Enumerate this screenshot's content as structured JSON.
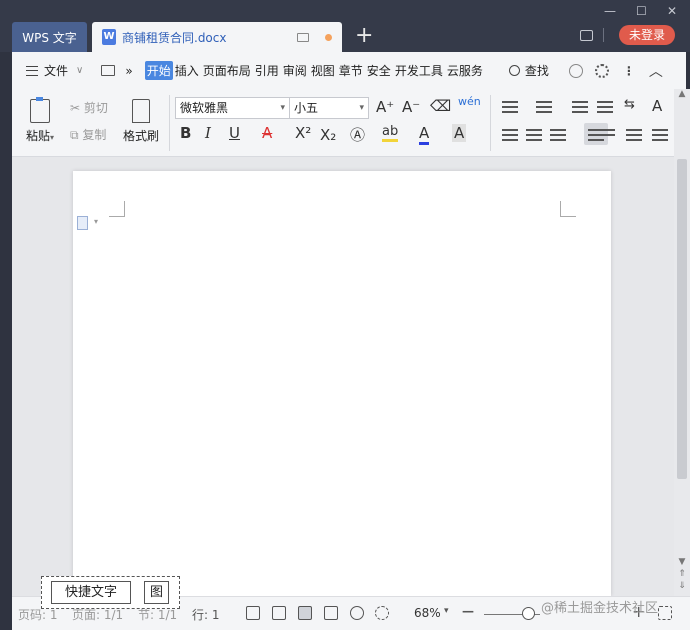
{
  "window": {
    "app_tab": "WPS 文字",
    "doc_tab": "商铺租赁合同.docx",
    "new_tab": "+",
    "login": "未登录",
    "min": "—",
    "max": "☐",
    "close": "✕"
  },
  "menubar": {
    "file": "文件",
    "file_arrow": "∨",
    "more": "»",
    "items": [
      "开始",
      "插入",
      "页面布局",
      "引用",
      "审阅",
      "视图",
      "章节",
      "安全",
      "开发工具",
      "云服务"
    ],
    "search": "查找"
  },
  "ribbon": {
    "paste": "粘贴",
    "cut": "剪切",
    "copy": "复制",
    "format_painter": "格式刷",
    "font_name": "微软雅黑",
    "font_size": "小五",
    "grow": "A⁺",
    "shrink": "A⁻",
    "pinyin": "wén",
    "bold": "B",
    "italic": "I",
    "underline": "U",
    "strike": "A",
    "superscript": "X²",
    "subscript": "X₂",
    "highlight": "ab",
    "font_color": "A",
    "char_shade": "A"
  },
  "status": {
    "page_no": "页码: 1",
    "pages": "页面: 1/1",
    "section": "节: 1/1",
    "row": "行: 1",
    "zoom": "68%",
    "zoom_out": "—",
    "zoom_in": "+"
  },
  "quick_bar": {
    "quick_text": "快捷文字",
    "image": "图"
  },
  "watermark": "@稀土掘金技术社区",
  "colors": {
    "titlebar": "#353a49",
    "app_tab": "#4a6190",
    "accent": "#4a87e0",
    "login": "#e05b4c"
  }
}
